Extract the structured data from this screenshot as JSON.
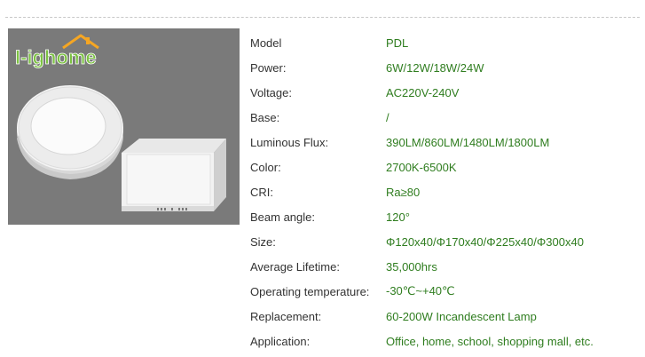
{
  "brand": {
    "logo_text": "I-ighome"
  },
  "colors": {
    "label": "#333333",
    "value": "#2f7d1f",
    "image_background": "#7a7a7a",
    "logo_green": "#7cc242",
    "logo_orange": "#f5a623"
  },
  "specs": [
    {
      "label": "Model",
      "value": "PDL"
    },
    {
      "label": "Power:",
      "value": "6W/12W/18W/24W"
    },
    {
      "label": "Voltage:",
      "value": "AC220V-240V"
    },
    {
      "label": "Base:",
      "value": "/"
    },
    {
      "label": "Luminous Flux:",
      "value": "390LM/860LM/1480LM/1800LM"
    },
    {
      "label": "Color:",
      "value": "2700K-6500K"
    },
    {
      "label": "CRI:",
      "value": "Ra≥80"
    },
    {
      "label": "Beam angle:",
      "value": "120°"
    },
    {
      "label": "Size:",
      "value": "Φ120x40/Φ170x40/Φ225x40/Φ300x40"
    },
    {
      "label": "Average Lifetime:",
      "value": "35,000hrs"
    },
    {
      "label": "Operating temperature:",
      "value": "-30℃~+40℃"
    },
    {
      "label": "Replacement:",
      "value": "60-200W Incandescent Lamp"
    },
    {
      "label": "Application:",
      "value": "Office, home, school, shopping mall, etc."
    }
  ]
}
